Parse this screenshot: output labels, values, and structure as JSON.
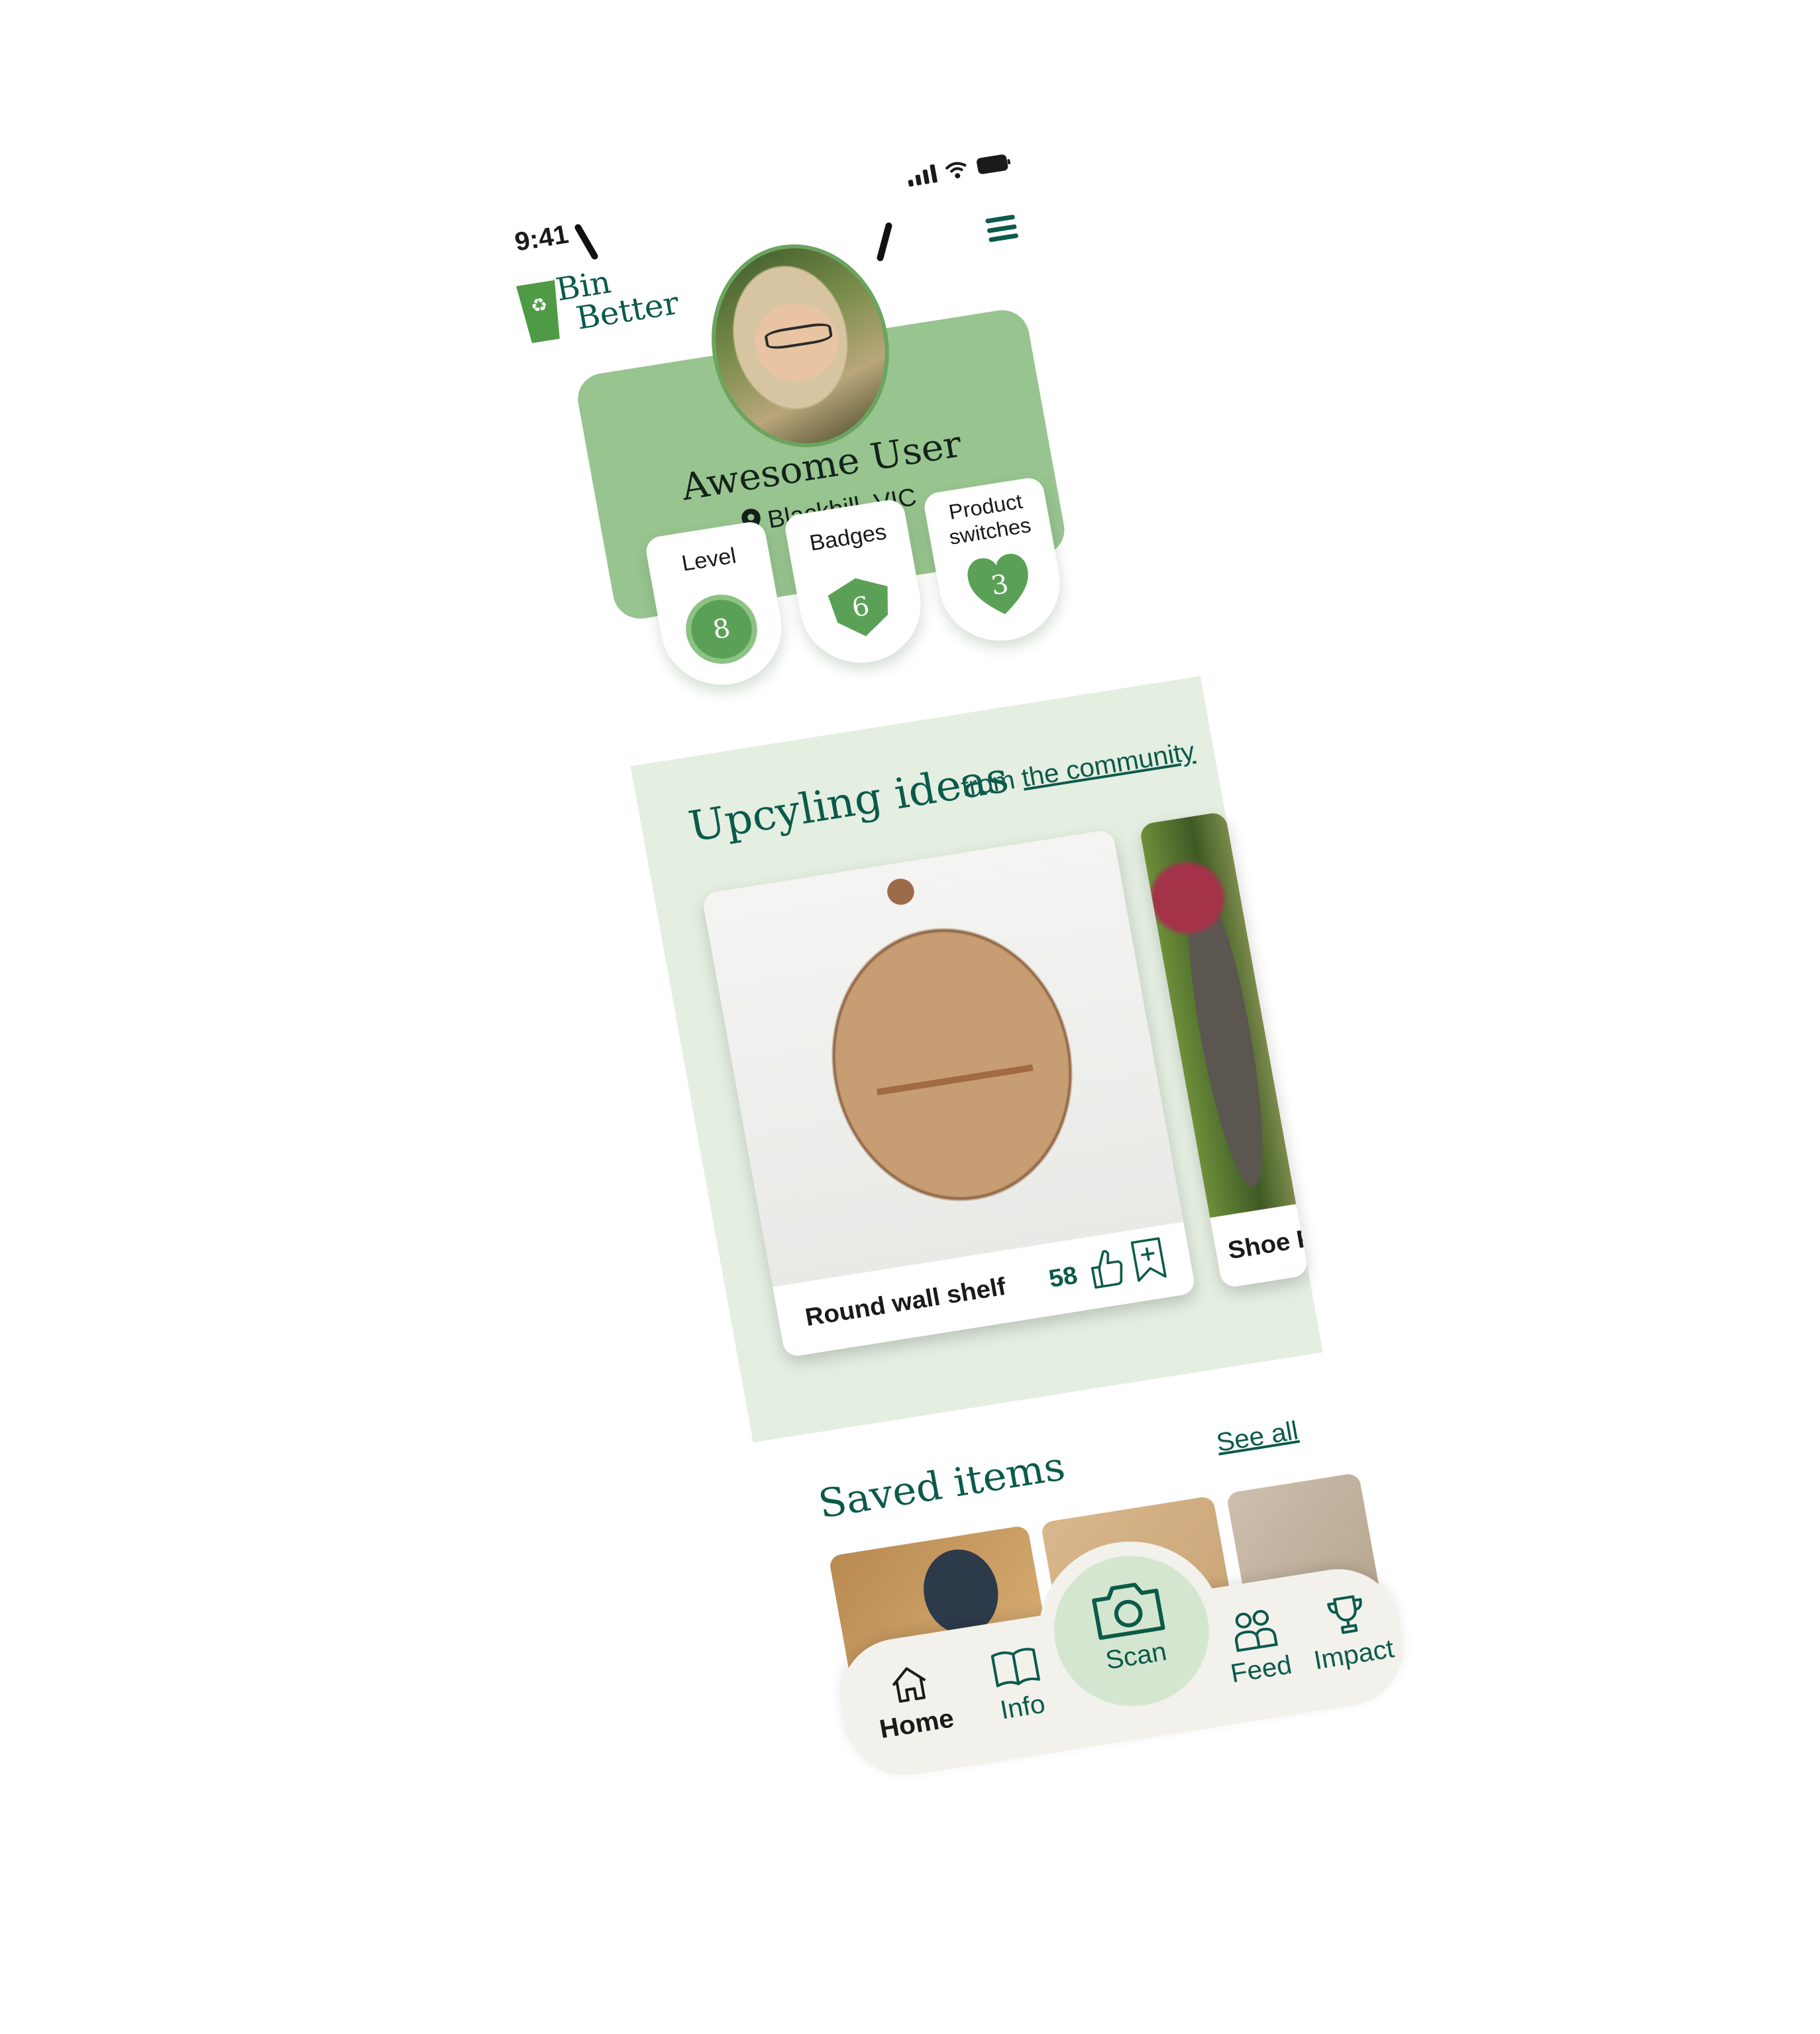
{
  "status_bar": {
    "time": "9:41"
  },
  "header": {
    "logo_line1": "Bin",
    "logo_line2": "Better",
    "menu_icon": "hamburger-menu-icon"
  },
  "profile": {
    "name": "Awesome User",
    "location": "Blackhill, VIC",
    "stats": [
      {
        "label": "Level",
        "value": "8"
      },
      {
        "label": "Badges",
        "value": "6"
      },
      {
        "label": "Product switches",
        "value": "3"
      }
    ]
  },
  "upcycling": {
    "title": "Upcyling ideas",
    "from_prefix": "from",
    "from_link": "the community",
    "cards": [
      {
        "name": "Round wall shelf",
        "likes": "58"
      },
      {
        "name": "Shoe Pla"
      }
    ]
  },
  "saved": {
    "title": "Saved items",
    "see_all": "See all"
  },
  "nav": {
    "home": "Home",
    "info": "Info",
    "scan": "Scan",
    "feed": "Feed",
    "impact": "Impact"
  },
  "colors": {
    "brand_dark": "#0b5a4a",
    "card_green": "#98c48f",
    "badge_green": "#5aa157",
    "section_bg": "#e4eee1"
  }
}
